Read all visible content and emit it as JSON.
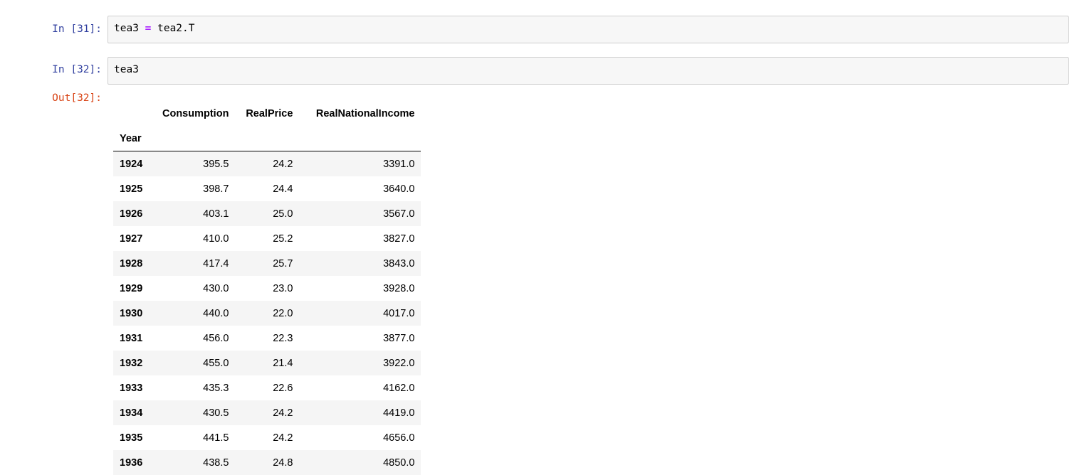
{
  "cells": [
    {
      "prompt": "In [31]:",
      "code_parts": [
        "tea3 ",
        "=",
        " tea2.T"
      ]
    },
    {
      "prompt": "In [32]:",
      "code": "tea3",
      "out_prompt": "Out[32]:"
    }
  ],
  "table": {
    "columns": [
      "Consumption",
      "RealPrice",
      "RealNationalIncome"
    ],
    "index_name": "Year",
    "rows": [
      [
        "1924",
        "395.5",
        "24.2",
        "3391.0"
      ],
      [
        "1925",
        "398.7",
        "24.4",
        "3640.0"
      ],
      [
        "1926",
        "403.1",
        "25.0",
        "3567.0"
      ],
      [
        "1927",
        "410.0",
        "25.2",
        "3827.0"
      ],
      [
        "1928",
        "417.4",
        "25.7",
        "3843.0"
      ],
      [
        "1929",
        "430.0",
        "23.0",
        "3928.0"
      ],
      [
        "1930",
        "440.0",
        "22.0",
        "4017.0"
      ],
      [
        "1931",
        "456.0",
        "22.3",
        "3877.0"
      ],
      [
        "1932",
        "455.0",
        "21.4",
        "3922.0"
      ],
      [
        "1933",
        "435.3",
        "22.6",
        "4162.0"
      ],
      [
        "1934",
        "430.5",
        "24.2",
        "4419.0"
      ],
      [
        "1935",
        "441.5",
        "24.2",
        "4656.0"
      ],
      [
        "1936",
        "438.5",
        "24.8",
        "4850.0"
      ]
    ]
  }
}
